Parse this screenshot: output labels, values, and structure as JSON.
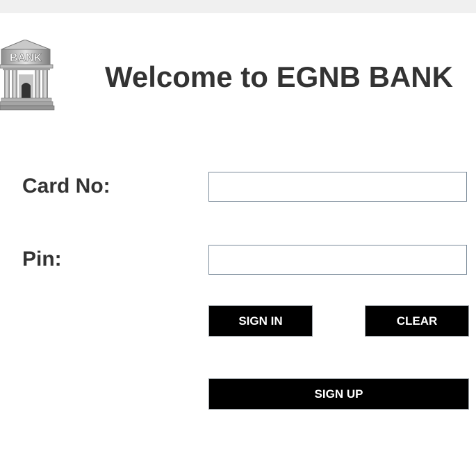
{
  "window": {
    "titlebar_color": "#f0f0f0"
  },
  "header": {
    "logo_text": "BANK",
    "title": "Welcome to EGNB BANK"
  },
  "form": {
    "card_label": "Card No:",
    "card_value": "",
    "pin_label": "Pin:",
    "pin_value": ""
  },
  "buttons": {
    "signin": "SIGN IN",
    "clear": "CLEAR",
    "signup": "SIGN UP"
  },
  "colors": {
    "button_bg": "#000000",
    "button_text": "#ffffff",
    "text": "#333333"
  }
}
